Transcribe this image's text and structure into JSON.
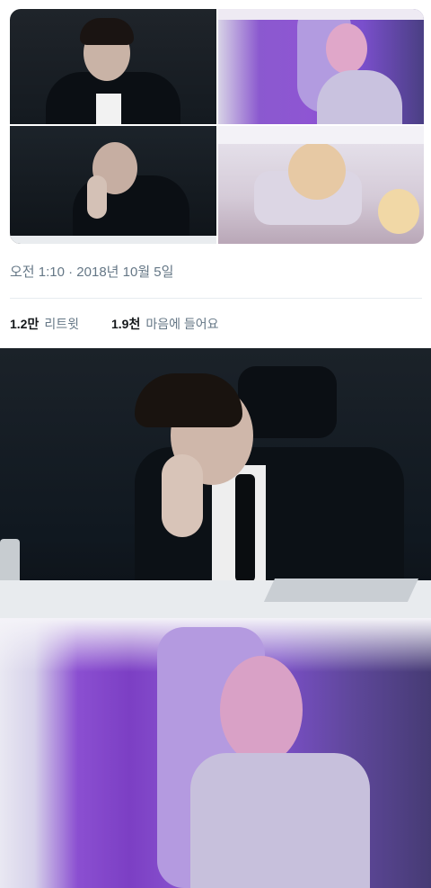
{
  "tweet": {
    "timestamp": "오전 1:10 · 2018년 10월 5일",
    "retweets": {
      "count": "1.2만",
      "label": "리트윗"
    },
    "likes": {
      "count": "1.9천",
      "label": "마음에 들어요"
    }
  },
  "colors": {
    "text_primary": "#14171a",
    "text_secondary": "#657786",
    "divider": "#e6ecf0",
    "photo_purple": "#8a56d0"
  }
}
